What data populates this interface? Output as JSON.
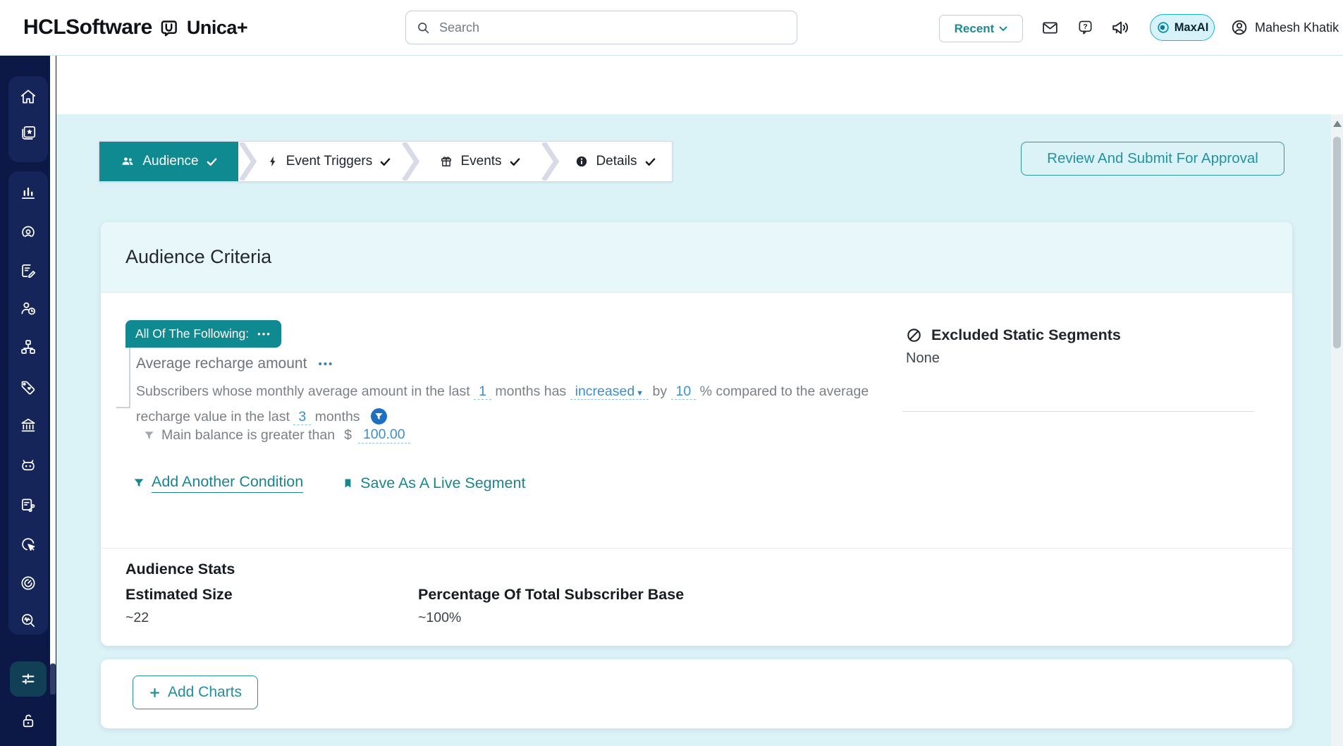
{
  "colors": {
    "accent_teal": "#0E8A90",
    "link_teal": "#1A8793",
    "sidebar_navy": "#0C1947",
    "page_cyan": "#DBF2F7",
    "card_header_cyan": "#E8F8FA",
    "value_blue": "#3E8EC9",
    "filter_badge_blue": "#1D70C1"
  },
  "header": {
    "logo_hcl": "HCLSoftware",
    "logo_unica": "Unica+",
    "search_placeholder": "Search",
    "recent_label": "Recent",
    "maxai_label": "MaxAI",
    "user_name": "Mahesh Khatik"
  },
  "sidebar": {
    "icons": [
      "home",
      "gallery-star",
      "bar-chart",
      "broadcast-person",
      "document-edit",
      "person-clock",
      "org-chart",
      "tag-heart",
      "bank",
      "robot",
      "document-flow",
      "cursor-click",
      "gauge",
      "search-wave",
      "sliders-settings",
      "lock-open"
    ]
  },
  "stepper": {
    "steps": [
      {
        "label": "Audience"
      },
      {
        "label": "Event Triggers"
      },
      {
        "label": "Events"
      },
      {
        "label": "Details"
      }
    ]
  },
  "actions": {
    "review_button": "Review And Submit For Approval",
    "add_charts": "Add Charts"
  },
  "criteria": {
    "title": "Audience Criteria",
    "group_label": "All Of The Following:",
    "menu_dots": "•••",
    "condition_name": "Average recharge amount",
    "sentence": {
      "l1_t1": "Subscribers whose monthly average amount in the last",
      "l1_v1": "1",
      "l1_t2": "months has",
      "l1_dd": "increased",
      "l1_t3": "by",
      "l1_v2": "10",
      "l1_t4": "% compared to the average",
      "l2_t1": "recharge value in the last",
      "l2_v1": "3",
      "l2_t2": "months"
    },
    "sub_condition": {
      "text": "Main balance is greater than",
      "currency": "$",
      "value": "100.00"
    },
    "links": {
      "add_condition": "Add Another Condition",
      "save_segment": "Save As A Live Segment"
    },
    "excluded": {
      "title": "Excluded Static Segments",
      "value": "None"
    }
  },
  "stats": {
    "title": "Audience Stats",
    "estimated_label": "Estimated Size",
    "estimated_value": "~22",
    "pct_label": "Percentage Of Total Subscriber Base",
    "pct_value": "~100%"
  }
}
